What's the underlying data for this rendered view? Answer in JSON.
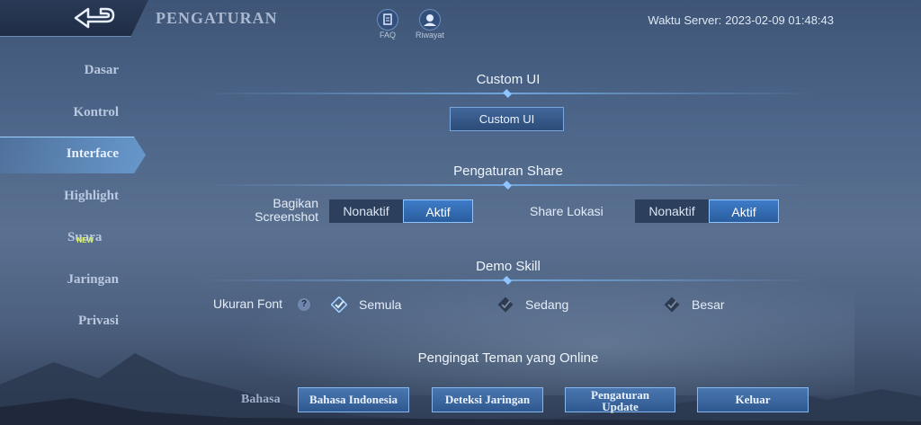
{
  "header": {
    "title": "PENGATURAN",
    "back_icon": "back-arrow-icon",
    "tools": [
      {
        "label": "FAQ",
        "icon": "faq-icon"
      },
      {
        "label": "Riwayat",
        "icon": "history-icon"
      }
    ],
    "server_time_label": "Waktu Server:",
    "server_time_value": "2023-02-09 01:48:43"
  },
  "sidebar": {
    "items": [
      {
        "label": "Dasar"
      },
      {
        "label": "Kontrol"
      },
      {
        "label": "Interface",
        "active": true
      },
      {
        "label": "Highlight"
      },
      {
        "label": "Suara",
        "badge": "NEW"
      },
      {
        "label": "Jaringan"
      },
      {
        "label": "Privasi"
      }
    ]
  },
  "sections": {
    "custom_ui": {
      "title": "Custom UI",
      "button": "Custom UI"
    },
    "share": {
      "title": "Pengaturan Share",
      "screenshot_label": "Bagikan\nScreenshot",
      "location_label": "Share Lokasi",
      "off": "Nonaktif",
      "on": "Aktif"
    },
    "demo_skill": {
      "title": "Demo Skill",
      "font_label": "Ukuran Font",
      "help": "?",
      "options": [
        "Semula",
        "Sedang",
        "Besar"
      ],
      "selected": "Semula"
    },
    "reminder": {
      "title": "Pengingat Teman yang Online"
    }
  },
  "bottom": {
    "language_label": "Bahasa",
    "language_button": "Bahasa Indonesia",
    "network_button": "Deteksi Jaringan",
    "update_button_line1": "Pengaturan",
    "update_button_line2": "Update",
    "logout_button": "Keluar"
  },
  "colors": {
    "accent": "#79a8e0",
    "active_toggle": "#3e7cc8",
    "badge": "#d9f26b"
  }
}
